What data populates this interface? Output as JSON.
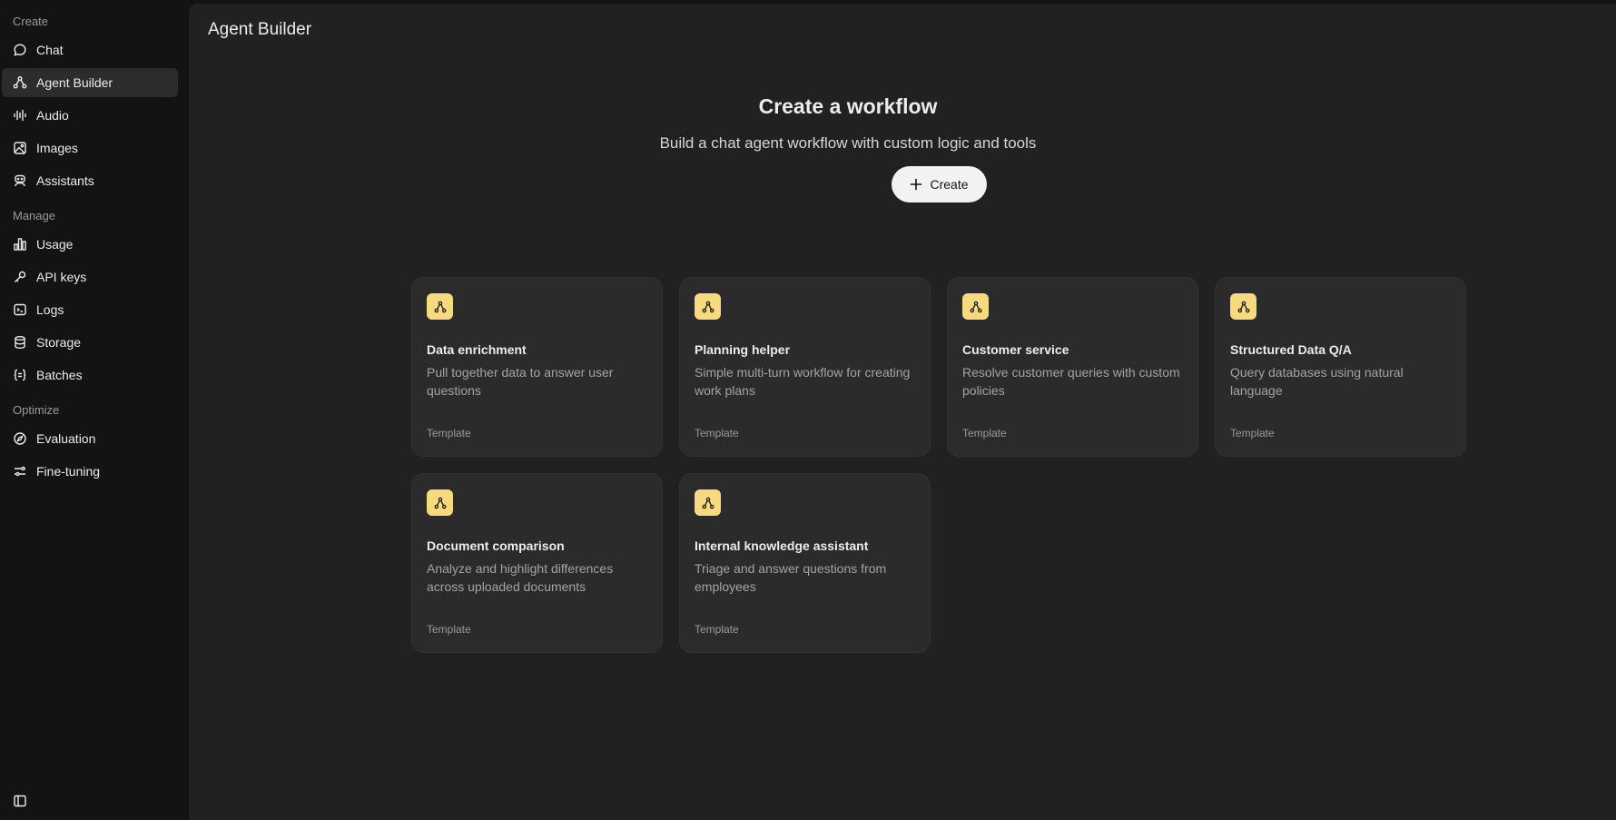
{
  "sidebar": {
    "sections": [
      {
        "label": "Create",
        "items": [
          {
            "label": "Chat",
            "icon": "chat-bubble-icon",
            "active": false
          },
          {
            "label": "Agent Builder",
            "icon": "agent-builder-icon",
            "active": true
          },
          {
            "label": "Audio",
            "icon": "audio-wave-icon",
            "active": false
          },
          {
            "label": "Images",
            "icon": "image-icon",
            "active": false
          },
          {
            "label": "Assistants",
            "icon": "robot-icon",
            "active": false
          }
        ]
      },
      {
        "label": "Manage",
        "items": [
          {
            "label": "Usage",
            "icon": "bar-chart-icon",
            "active": false
          },
          {
            "label": "API keys",
            "icon": "key-icon",
            "active": false
          },
          {
            "label": "Logs",
            "icon": "terminal-icon",
            "active": false
          },
          {
            "label": "Storage",
            "icon": "database-icon",
            "active": false
          },
          {
            "label": "Batches",
            "icon": "braces-icon",
            "active": false
          }
        ]
      },
      {
        "label": "Optimize",
        "items": [
          {
            "label": "Evaluation",
            "icon": "compass-icon",
            "active": false
          },
          {
            "label": "Fine-tuning",
            "icon": "sliders-icon",
            "active": false
          }
        ]
      }
    ],
    "toggle_icon": "sidebar-toggle-icon"
  },
  "header": {
    "title": "Agent Builder"
  },
  "hero": {
    "title": "Create a workflow",
    "subtitle": "Build a chat agent workflow with custom logic and tools",
    "create_label": "Create"
  },
  "templates": [
    {
      "title": "Data enrichment",
      "description": "Pull together data to answer user questions",
      "tag": "Template"
    },
    {
      "title": "Planning helper",
      "description": "Simple multi-turn workflow for creating work plans",
      "tag": "Template"
    },
    {
      "title": "Customer service",
      "description": "Resolve customer queries with custom policies",
      "tag": "Template"
    },
    {
      "title": "Structured Data Q/A",
      "description": "Query databases using natural language",
      "tag": "Template"
    },
    {
      "title": "Document comparison",
      "description": "Analyze and highlight differences across uploaded documents",
      "tag": "Template"
    },
    {
      "title": "Internal knowledge assistant",
      "description": "Triage and answer questions from employees",
      "tag": "Template"
    }
  ],
  "colors": {
    "accent_badge": "#f6da7d",
    "main_bg": "#212121",
    "sidebar_bg": "#131313",
    "card_bg": "#2b2b2b"
  }
}
